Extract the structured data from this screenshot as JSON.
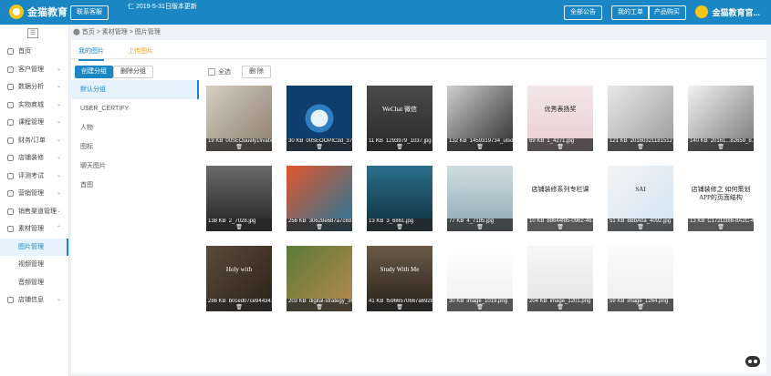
{
  "header": {
    "logo_text": "金猫教育",
    "contact_label": "联系客服",
    "notice_line1": "仁",
    "notice_line2": "2019-5-31日版本更新",
    "buttons": [
      "全部公告",
      "我的工单",
      "产品购买"
    ],
    "org_name": "金猫教育官..."
  },
  "sidebar": {
    "collapse_glyph": "☰",
    "items": [
      {
        "label": "首页",
        "icon": "home-icon",
        "chevron": ""
      },
      {
        "label": "客户管理",
        "icon": "users-icon",
        "chevron": "⌄"
      },
      {
        "label": "数据分析",
        "icon": "chart-icon",
        "chevron": "⌄"
      },
      {
        "label": "实物商城",
        "icon": "shop-icon",
        "chevron": "⌄"
      },
      {
        "label": "课程管理",
        "icon": "course-icon",
        "chevron": "⌄"
      },
      {
        "label": "财务/订单",
        "icon": "wallet-icon",
        "chevron": "⌄"
      },
      {
        "label": "店铺装修",
        "icon": "brush-icon",
        "chevron": "⌄"
      },
      {
        "label": "评测考试",
        "icon": "exam-icon",
        "chevron": "⌄"
      },
      {
        "label": "营销管理",
        "icon": "gift-icon",
        "chevron": "⌄"
      },
      {
        "label": "销售渠道管理",
        "icon": "channel-icon",
        "chevron": "⌄"
      },
      {
        "label": "素材管理",
        "icon": "folder-icon",
        "chevron": "⌃"
      },
      {
        "label": "图片管理",
        "icon": "",
        "chevron": "",
        "sub": true,
        "active": true
      },
      {
        "label": "视频管理",
        "icon": "",
        "chevron": "",
        "sub": true
      },
      {
        "label": "音频管理",
        "icon": "",
        "chevron": "",
        "sub": true
      },
      {
        "label": "店铺信息",
        "icon": "info-icon",
        "chevron": "⌄"
      }
    ]
  },
  "breadcrumb": {
    "home": "首页",
    "sep": ">",
    "level1": "素材管理",
    "level2": "图片管理"
  },
  "tabs": {
    "my_images": "我的图片",
    "upload": "上传图片"
  },
  "toolbar": {
    "create_group": "创建分组",
    "delete_group": "删除分组",
    "select_all": "全选",
    "delete": "删 除"
  },
  "groups": [
    "默认分组",
    "USER_CERTIFY",
    "人物",
    "图标",
    "聊天图片",
    "首图"
  ],
  "images": [
    {
      "size": "19 KB",
      "name": "00SEOuuely1fivafx2..."
    },
    {
      "size": "30 KB",
      "name": "00SEOOPIC3d_375..."
    },
    {
      "size": "11 KB",
      "name": "1293979_1037.jpg",
      "art_text": "WeChat 微信"
    },
    {
      "size": "132 KB",
      "name": "1459319734_ulsoo..."
    },
    {
      "size": "69 KB",
      "name": "1_4271.jpg",
      "art_text": "优秀表扬奖"
    },
    {
      "size": "121 KB",
      "name": "20160321181512_5..."
    },
    {
      "size": "140 KB",
      "name": "20161...82659_8..."
    },
    {
      "size": "138 KB",
      "name": "2_7028.jpg"
    },
    {
      "size": "256 KB",
      "name": "30628e687a7c8d7..."
    },
    {
      "size": "13 KB",
      "name": "3_6861.jpg"
    },
    {
      "size": "77 KB",
      "name": "4_7185.jpg"
    },
    {
      "size": "10 KB",
      "name": "88644f85-0962-46...",
      "art_text": "店铺装修系列专栏课"
    },
    {
      "size": "51 KB",
      "name": "8BbA0a_4092.jpg",
      "art_text": "SAI"
    },
    {
      "size": "13 KB",
      "name": "C172D386-8A2C-46...",
      "art_text": "店铺装修之 如何策划APP的页面结构"
    },
    {
      "size": "286 KB",
      "name": "b0ced07ce9443419...",
      "art_text": "Holy with"
    },
    {
      "size": "203 KB",
      "name": "digital-strategy_36..."
    },
    {
      "size": "41 KB",
      "name": "f5966570667a69280...",
      "art_text": "Study With Me"
    },
    {
      "size": "30 KB",
      "name": "image_1019.png"
    },
    {
      "size": "204 KB",
      "name": "image_1201.png"
    },
    {
      "size": "59 KB",
      "name": "image_1264.png"
    }
  ],
  "trash_glyph": "🗑"
}
